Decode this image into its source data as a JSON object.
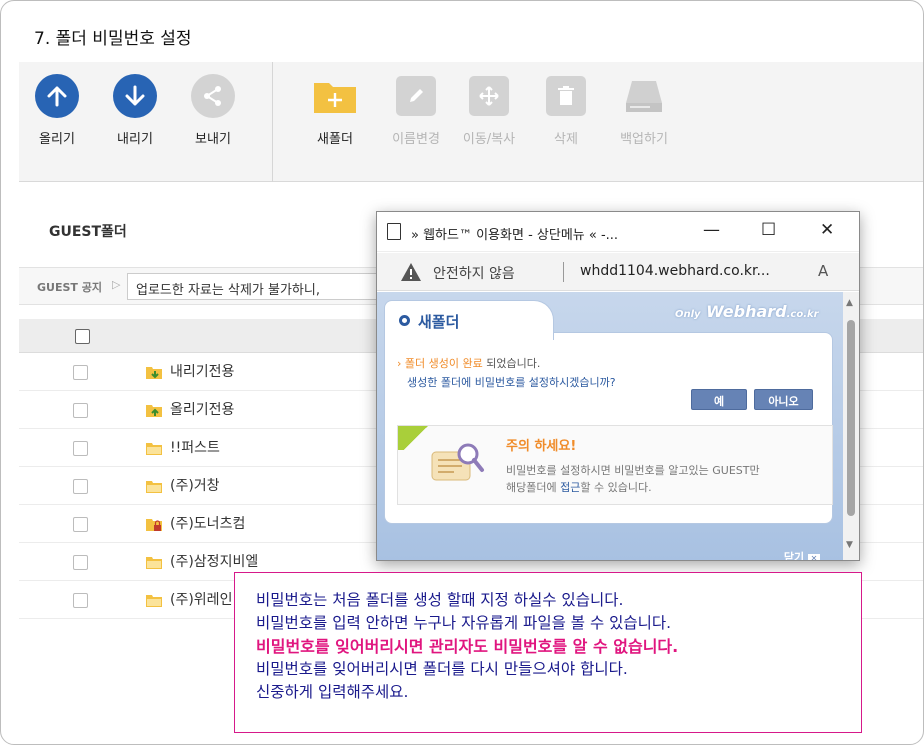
{
  "page": {
    "title": "7. 폴더 비밀번호 설정"
  },
  "toolbar": {
    "upload": "올리기",
    "download": "내리기",
    "send": "보내기",
    "new_folder": "새폴더",
    "rename": "이름변경",
    "move_copy": "이동/복사",
    "delete": "삭제",
    "backup": "백업하기"
  },
  "guest": {
    "title": "GUEST폴더",
    "notice_label": "GUEST 공지",
    "notice_text": "업로드한 자료는 삭제가 불가하니,"
  },
  "folders": [
    {
      "name": "내리기전용",
      "icon": "download-folder-icon"
    },
    {
      "name": "올리기전용",
      "icon": "upload-folder-icon"
    },
    {
      "name": "!!퍼스트",
      "icon": "folder-icon"
    },
    {
      "name": "(주)거창",
      "icon": "folder-icon"
    },
    {
      "name": "(주)도너츠컴",
      "icon": "locked-folder-icon"
    },
    {
      "name": "(주)삼정지비엘",
      "icon": "folder-icon"
    },
    {
      "name": "(주)위레인",
      "icon": "folder-icon"
    }
  ],
  "popup": {
    "window_title": "» 웹하드™ 이용화면 - 상단메뉴 « -...",
    "insecure_label": "안전하지 않음",
    "url": "whdd1104.webhard.co.kr...",
    "read_aloud": "A",
    "header_title": "새폴더",
    "brand": "Webhard",
    "brand_prefix": "Only",
    "brand_suffix": ".co.kr",
    "message_highlight": "폴더 생성이 완료",
    "message_rest": " 되었습니다.",
    "question": "생성한 폴더에 비밀번호를 설정하시겠습니까?",
    "yes": "예",
    "no": "아니오",
    "caution_title": "주의 하세요!",
    "caution_line1": "비밀번호를 설정하시면 비밀번호를 알고있는 GUEST만",
    "caution_line2_a": "해당폴더에 ",
    "caution_line2_b": "접근",
    "caution_line2_c": "할 수 있습니다.",
    "close": "닫기"
  },
  "info": {
    "line1": "비밀번호는 처음 폴더를 생성 할때 지정 하실수 있습니다.",
    "line2": "비밀번호를 입력 안하면 누구나 자유롭게 파일을 볼 수 있습니다.",
    "line3": "비밀번호를 잊어버리시면 관리자도 비밀번호를 알 수 없습니다.",
    "line4": "비밀번호를 잊어버리시면 폴더를 다시 만들으셔야 합니다.",
    "line5": "신중하게 입력해주세요."
  },
  "colors": {
    "primary_blue": "#2864b4",
    "info_border": "#d6198a",
    "info_text": "#1a1a8c",
    "info_emphasis": "#e0157f",
    "folder_yellow": "#f3c141"
  }
}
